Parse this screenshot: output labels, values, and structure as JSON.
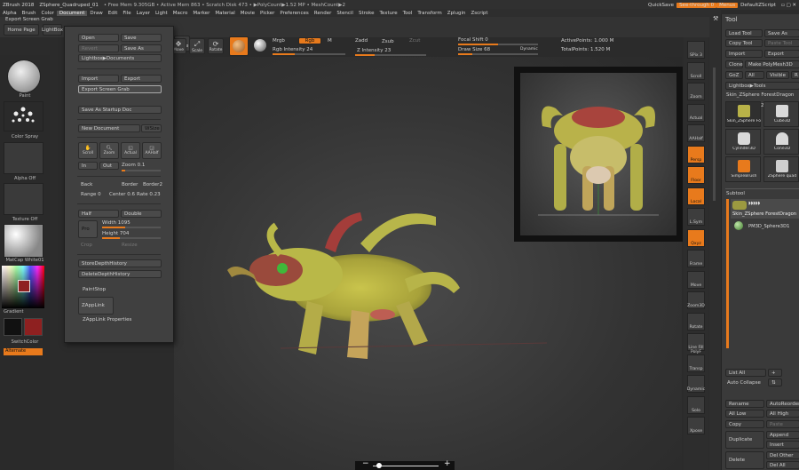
{
  "titlebar": {
    "app": "ZBrush 2018",
    "doc": "ZSphere_Quadruped_01",
    "stats": "• Free Mem 9.305GB • Active Mem 863 • Scratch Disk 473 • ▶PolyCount▶1.52 MP • MeshCount▶2",
    "quicksave": "QuickSave",
    "seethrough": "See-through 0",
    "menus": "Menus",
    "defaultscript": "DefaultZScript"
  },
  "menubar": [
    "Alpha",
    "Brush",
    "Color",
    "Document",
    "Draw",
    "Edit",
    "File",
    "Layer",
    "Light",
    "Macro",
    "Marker",
    "Material",
    "Movie",
    "Picker",
    "Preferences",
    "Render",
    "Stencil",
    "Stroke",
    "Texture",
    "Tool",
    "Transform",
    "Zplugin",
    "Zscript"
  ],
  "toolbar": {
    "export_screen_grab": "Export Screen Grab",
    "home_page": "Home Page",
    "lightbox": "LightBox",
    "move": "Move",
    "scale": "Scale",
    "rotate": "Rotate",
    "mrgb": "Mrgb",
    "rgb": "Rgb",
    "m": "M",
    "rgb_intensity": "Rgb Intensity 24",
    "zadd": "Zadd",
    "zsub": "Zsub",
    "zcut": "Zcut",
    "z_intensity": "Z Intensity 23",
    "focal_shift": "Focal Shift 0",
    "draw_size": "Draw Size 68",
    "dynamic": "Dynamic",
    "active_points": "ActivePoints: 1.000 M",
    "total_points": "TotalPoints: 1.520 M"
  },
  "leftpanel": {
    "paint": "Paint",
    "color_spray": "Color Spray",
    "alpha_off": "Alpha Off",
    "texture_off": "Texture Off",
    "matcap": "MatCap White01",
    "gradient": "Gradient",
    "switchcolor": "SwitchColor",
    "alternate": "Alternate"
  },
  "document_menu": {
    "open": "Open",
    "save": "Save",
    "revert": "Revert",
    "save_as": "Save As",
    "lightbox_documents": "Lightbox▶Documents",
    "import": "Import",
    "export": "Export",
    "export_screen_grab": "Export Screen Grab",
    "save_startup": "Save As Startup Doc",
    "new_document": "New Document",
    "wsize": "WSize",
    "scroll": "Scroll",
    "zoom": "Zoom",
    "actual": "Actual",
    "aaHalf": "AAHalf",
    "in": "In",
    "out": "Out",
    "zoom_val": "Zoom 0.1",
    "back": "Back",
    "border": "Border",
    "border2": "Border2",
    "range": "Range 0",
    "center": "Center 0.6",
    "rate": "Rate 0.23",
    "half": "Half",
    "double": "Double",
    "pro": "Pro",
    "width": "Width 1095",
    "height": "Height 704",
    "crop": "Crop",
    "resize": "Resize",
    "store_depth": "StoreDepthHistory",
    "delete_depth": "DeleteDepthHistory",
    "paintstop": "PaintStop",
    "zapplink": "ZAppLink",
    "zapplink_props": "ZAppLink Properties"
  },
  "rightshelf": [
    "SPix 3",
    "Scroll",
    "Zoom",
    "Actual",
    "AAHalf",
    "Persp",
    "Floor",
    "Local",
    "L.Sym",
    "Qxyz",
    "Frame",
    "Move",
    "Zoom3D",
    "Rotate",
    "Line Fill PolyF",
    "Transp",
    "Dynamic",
    "Solo",
    "Xpose"
  ],
  "toolpanel": {
    "title": "Tool",
    "load_tool": "Load Tool",
    "save_as": "Save As",
    "copy_tool": "Copy Tool",
    "paste_tool": "Paste Tool",
    "import": "Import",
    "export": "Export",
    "clone": "Clone",
    "make_polymesh": "Make PolyMesh3D",
    "goz": "GoZ",
    "all": "All",
    "visible": "Visible",
    "r": "R",
    "lightbox_tools": "Lightbox▶Tools",
    "current_tool": "Skin_ZSphere ForestDragon",
    "count": "2",
    "thumbs": [
      "Skin_ZSphere Fo",
      "Cube3D",
      "Cylinder3D",
      "Cone3D",
      "SimpleBrush",
      "ZSphere quad"
    ],
    "subtool": "Subtool",
    "subtool_items": [
      "Skin_ZSphere ForestDragon",
      "PM3D_Sphere3D1"
    ],
    "list_all": "List All",
    "auto_collapse": "Auto Collapse",
    "rename": "Rename",
    "auto_reorder": "AutoReorder",
    "all_low": "All Low",
    "all_high": "All High",
    "copy": "Copy",
    "paste": "Paste",
    "duplicate": "Duplicate",
    "append": "Append",
    "insert": "Insert",
    "delete": "Delete",
    "del_other": "Del Other",
    "del_all": "Del All"
  },
  "colors": {
    "accent": "#e87a1c",
    "model_yellow": "#c7c24a",
    "model_red": "#b5433d"
  },
  "bottom_zoom": {
    "minus": "−",
    "plus": "+"
  }
}
